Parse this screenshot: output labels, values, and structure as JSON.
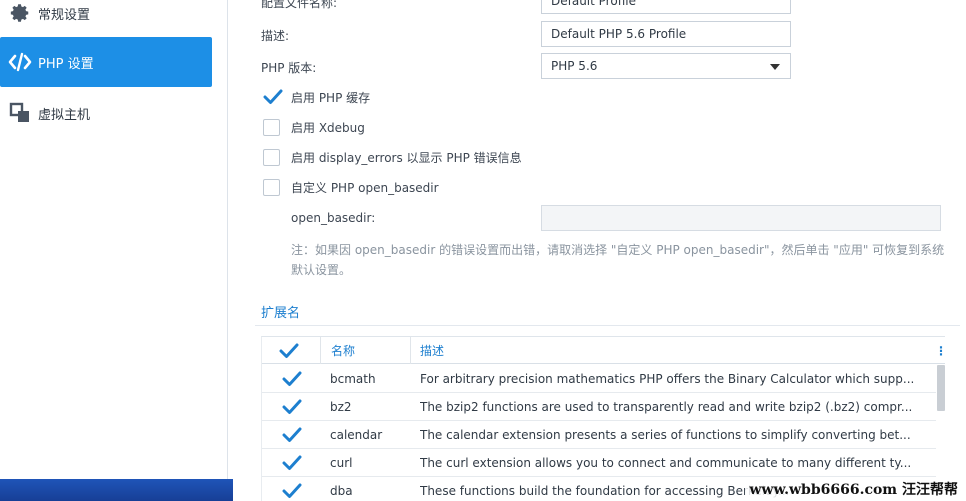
{
  "sidebar": {
    "items": [
      {
        "label": "常规设置",
        "icon": "gear-icon",
        "active": false
      },
      {
        "label": "PHP 设置",
        "icon": "code-icon",
        "active": true
      },
      {
        "label": "虚拟主机",
        "icon": "virtual-host-icon",
        "active": false
      }
    ]
  },
  "form": {
    "profile_name_label": "配置文件名称:",
    "profile_name_value": "Default Profile",
    "description_label": "描述:",
    "description_value": "Default PHP 5.6 Profile",
    "php_version_label": "PHP 版本:",
    "php_version_value": "PHP 5.6",
    "checkboxes": [
      {
        "label": "启用 PHP 缓存",
        "checked": true
      },
      {
        "label": "启用 Xdebug",
        "checked": false
      },
      {
        "label": "启用 display_errors 以显示 PHP 错误信息",
        "checked": false
      },
      {
        "label": "自定义 PHP open_basedir",
        "checked": false
      }
    ],
    "open_basedir_label": "open_basedir:",
    "open_basedir_value": "",
    "note_line1": "注：如果因 open_basedir 的错误设置而出错，请取消选择 \"自定义 PHP open_basedir\"，然后单击 \"应用\" 可恢复到系统",
    "note_line2": "默认设置。"
  },
  "extensions": {
    "section_title": "扩展名",
    "columns": {
      "name": "名称",
      "description": "描述"
    },
    "rows": [
      {
        "checked": true,
        "name": "bcmath",
        "description": "For arbitrary precision mathematics PHP offers the Binary Calculator which supp..."
      },
      {
        "checked": true,
        "name": "bz2",
        "description": "The bzip2 functions are used to transparently read and write bzip2 (.bz2) compr..."
      },
      {
        "checked": true,
        "name": "calendar",
        "description": "The calendar extension presents a series of functions to simplify converting bet..."
      },
      {
        "checked": true,
        "name": "curl",
        "description": "The curl extension allows you to connect and communicate to many different ty..."
      },
      {
        "checked": true,
        "name": "dba",
        "description": "These functions build the foundation for accessing Berkeley..."
      }
    ]
  },
  "watermark": "www.wbb6666.com 汪汪帮帮",
  "colors": {
    "accent": "#1d8fe6",
    "check": "#1d7fcf"
  }
}
